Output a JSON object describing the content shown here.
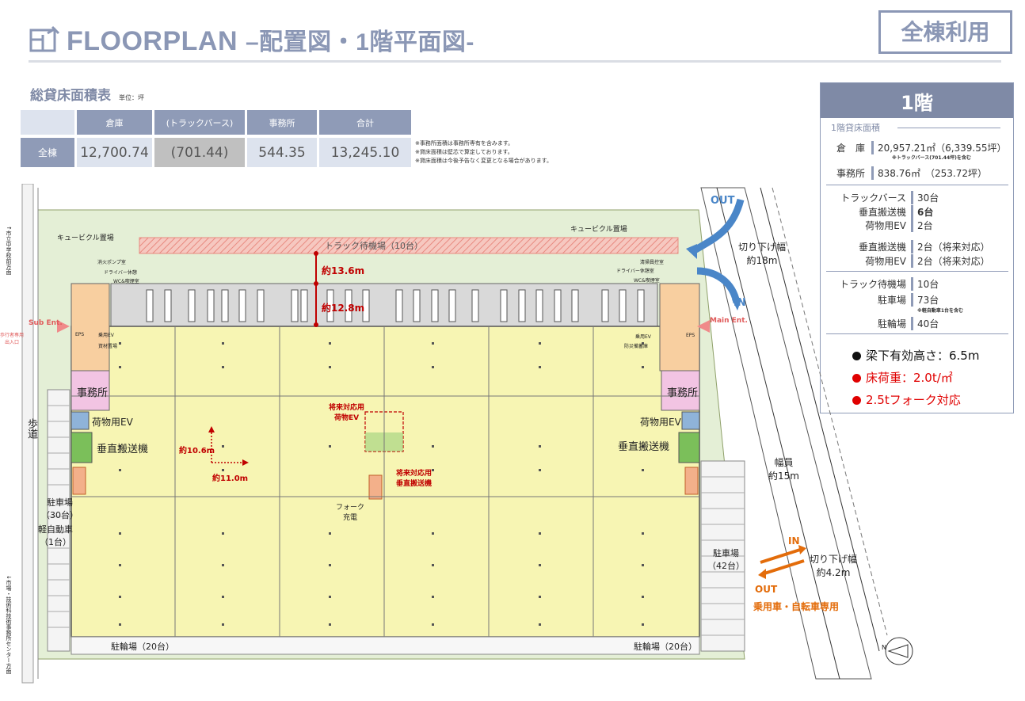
{
  "header": {
    "title": "FLOORPLAN",
    "subtitle": "–配置図・1階平面図-",
    "badge": "全棟利用",
    "icon": "floorplan-icon"
  },
  "area_table": {
    "title": "総貸床面積表",
    "unit": "単位：坪",
    "headers": [
      "倉庫",
      "(トラックバース)",
      "事務所",
      "合計"
    ],
    "row_label": "全棟",
    "values": [
      "12,700.74",
      "(701.44)",
      "544.35",
      "13,245.10"
    ],
    "notes": [
      "※事務所面積は事務所専有を含みます。",
      "※貸床面積は壁芯で算定しております。",
      "※貸床面積は今後予告なく変更となる場合があります。"
    ]
  },
  "panel": {
    "title": "1階",
    "section": "1階貸床面積",
    "warehouse_label": "倉　庫",
    "warehouse_value": "20,957.21㎡（6,339.55坪）",
    "warehouse_note": "※トラックバース(701.44坪)を含む",
    "office_label": "事務所",
    "office_value": "838.76㎡　（253.72坪）",
    "rows": [
      {
        "label": "トラックバース",
        "value": "30台"
      },
      {
        "label": "垂直搬送機",
        "value": "6台"
      },
      {
        "label": "荷物用EV",
        "value": "2台"
      },
      {
        "label": "垂直搬送機",
        "value": "2台（将来対応）"
      },
      {
        "label": "荷物用EV",
        "value": "2台（将来対応）"
      },
      {
        "label": "トラック待機場",
        "value": "10台"
      },
      {
        "label": "駐車場",
        "value": "73台"
      },
      {
        "label": "駐輪場",
        "value": "40台"
      }
    ],
    "parking_note": "※軽自動車1台を含む",
    "specs": [
      {
        "text": "梁下有効高さ：6.5m",
        "color": "#111111"
      },
      {
        "text": "床荷重：2.0t/㎡",
        "color": "#e00000"
      },
      {
        "text": "2.5tフォーク対応",
        "color": "#e00000"
      }
    ]
  },
  "plan": {
    "truck_waiting": "トラック待機場（10台）",
    "cubicle_left": "キュービクル置場",
    "cubicle_right": "キュービクル置場",
    "dim_13_6": "約13.6m",
    "dim_12_8": "約12.8m",
    "dim_10_6": "約10.6m",
    "dim_11_0": "約11.0m",
    "future_ev": "将来対応用\n荷物EV",
    "future_lift": "将来対応用\n垂直搬送機",
    "office_left": "事務所",
    "office_right": "事務所",
    "ev_left": "荷物用EV",
    "ev_right": "荷物用EV",
    "lift_left": "垂直搬送機",
    "lift_right": "垂直搬送機",
    "fork": "フォーク\n充電",
    "parking_left": "駐車場\n（30台）",
    "kei_left": "軽自動車\n（1台）",
    "parking_right": "駐車場\n（42台）",
    "bike_left": "駐輪場（20台）",
    "bike_right": "駐輪場（20台）",
    "sidewalk": "歩道",
    "out_top": "OUT",
    "in_top": "IN",
    "cut_top": "切り下げ幅\n約18m",
    "width_road": "幅員\n約15m",
    "in_bottom": "IN",
    "out_bottom": "OUT",
    "cut_bottom": "切り下げ幅\n約4.2m",
    "car_use": "乗用車・自転車専用",
    "sub_ent": "Sub Ent.",
    "main_ent": "Main Ent.",
    "ped_entrance": "歩行者専用\n出入口",
    "left_road_top": "↑市立中学校前方面",
    "left_road_bottom": "↓市場・技術科技術事務所センター方面",
    "small_left": [
      "消火ポンプ室",
      "ドライバー休憩",
      "WC&喫煙室",
      "乗用EV",
      "資材置場",
      "EPS"
    ],
    "small_right": [
      "清掃員控室",
      "ドライバー休憩室",
      "WC&喫煙室",
      "乗用EV",
      "防災備蓄庫",
      "EPS"
    ],
    "north": "N"
  }
}
